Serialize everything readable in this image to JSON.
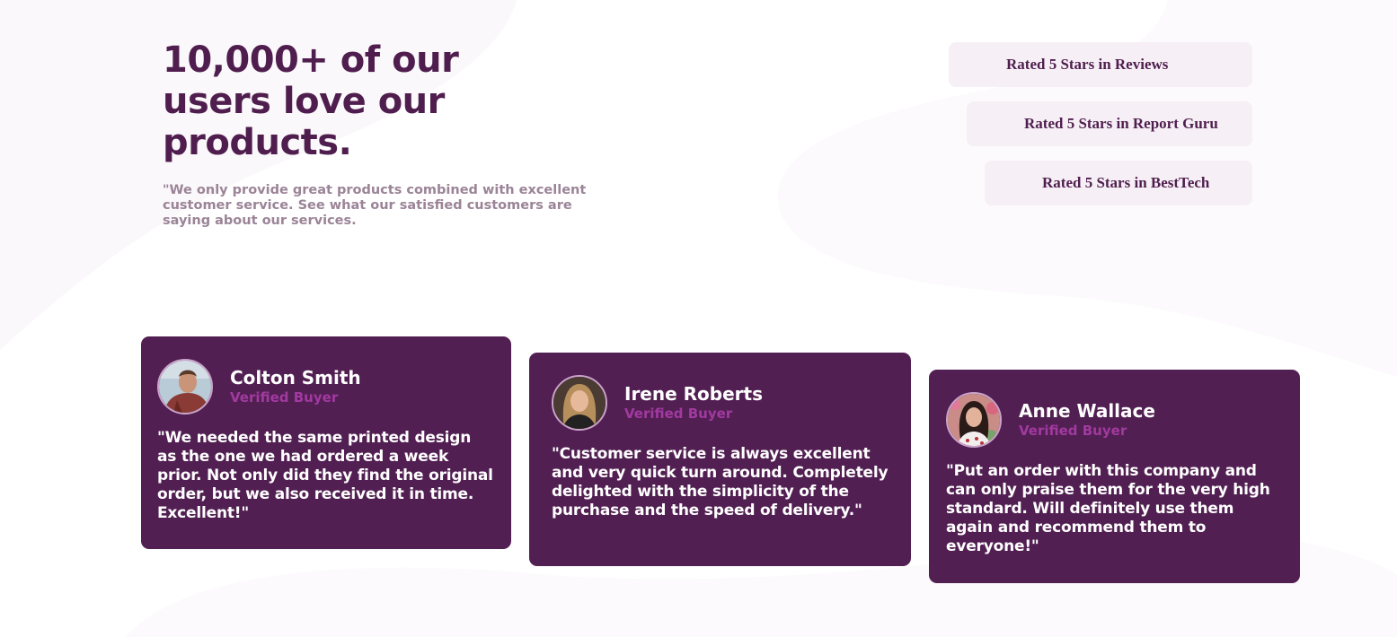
{
  "header": {
    "title": "10,000+ of our users love our products.",
    "intro": "\"We only provide great products combined with excellent customer service. See what our satisfied customers are saying about our services."
  },
  "ratings": [
    {
      "label": "Rated 5 Stars in Reviews",
      "stars": 5
    },
    {
      "label": "Rated 5 Stars in Report Guru",
      "stars": 5
    },
    {
      "label": "Rated 5 Stars in BestTech",
      "stars": 5
    }
  ],
  "testimonials": [
    {
      "name": "Colton Smith",
      "badge": "Verified Buyer",
      "quote": "\"We needed the same printed design as the one we had ordered a week prior. Not only did they find the original order, but we also received it in time. Excellent!\""
    },
    {
      "name": "Irene Roberts",
      "badge": "Verified Buyer",
      "quote": "\"Customer service is always excellent and very quick turn around. Completely delighted with the simplicity of the purchase and the speed of delivery.\""
    },
    {
      "name": "Anne Wallace",
      "badge": "Verified Buyer",
      "quote": "\"Put an order with this company and can only praise them for the very high standard. Will definitely use them again and recommend them to everyone!\""
    }
  ],
  "colors": {
    "primary": "#4f1e4e",
    "card_bg": "#521f52",
    "accent": "#a13aa0",
    "muted_text": "#9b8497",
    "rating_bg": "#f6f0f6"
  }
}
